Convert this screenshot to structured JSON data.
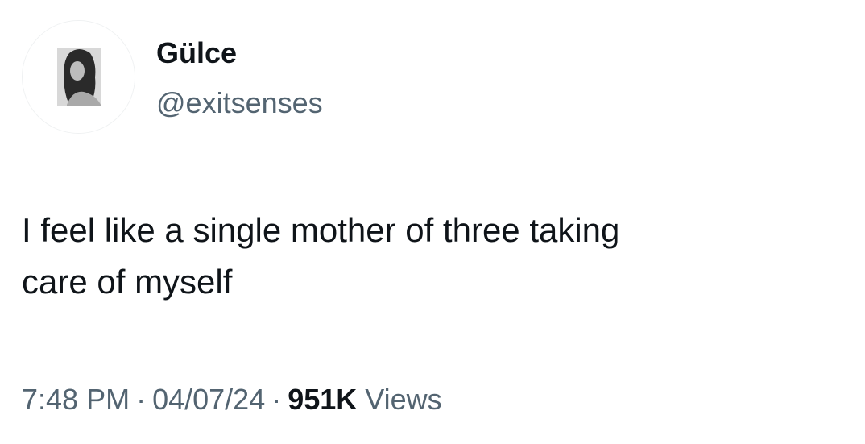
{
  "author": {
    "display_name": "Gülce",
    "handle": "@exitsenses"
  },
  "tweet": {
    "text": "I feel like a single mother of three taking\ncare of myself"
  },
  "meta": {
    "time": "7:48 PM",
    "separator": "·",
    "date": "04/07/24",
    "view_count": "951K",
    "views_label": "Views"
  },
  "colors": {
    "text_primary": "#0f1419",
    "text_secondary": "#536471",
    "background": "#ffffff"
  },
  "icons": {
    "avatar": "profile-photo"
  }
}
